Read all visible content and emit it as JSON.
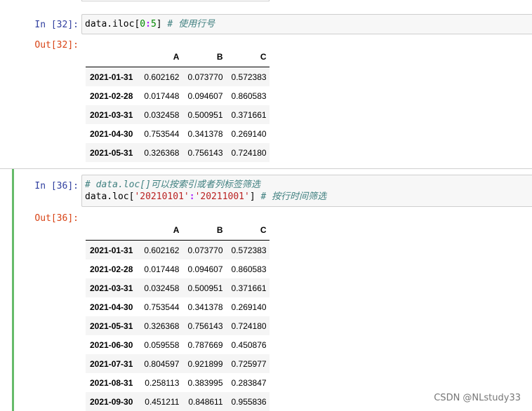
{
  "cells": [
    {
      "in_prompt": "In [32]:",
      "out_prompt": "Out[32]:",
      "code": {
        "line1": {
          "pre": "data.iloc[",
          "n1": "0",
          "colon": ":",
          "n2": "5",
          "post": "] ",
          "comment": "# 使用行号"
        }
      },
      "table": {
        "columns": [
          "A",
          "B",
          "C"
        ],
        "rows": [
          {
            "index": "2021-01-31",
            "values": [
              "0.602162",
              "0.073770",
              "0.572383"
            ]
          },
          {
            "index": "2021-02-28",
            "values": [
              "0.017448",
              "0.094607",
              "0.860583"
            ]
          },
          {
            "index": "2021-03-31",
            "values": [
              "0.032458",
              "0.500951",
              "0.371661"
            ]
          },
          {
            "index": "2021-04-30",
            "values": [
              "0.753544",
              "0.341378",
              "0.269140"
            ]
          },
          {
            "index": "2021-05-31",
            "values": [
              "0.326368",
              "0.756143",
              "0.724180"
            ]
          }
        ]
      }
    },
    {
      "in_prompt": "In [36]:",
      "out_prompt": "Out[36]:",
      "code": {
        "line1": {
          "comment": "# data.loc[]可以按索引或者列标签筛选"
        },
        "line2": {
          "pre": "data.loc[",
          "s1": "'20210101'",
          "colon": ":",
          "s2": "'20211001'",
          "post": "] ",
          "comment": "# 按行时间筛选"
        }
      },
      "table": {
        "columns": [
          "A",
          "B",
          "C"
        ],
        "rows": [
          {
            "index": "2021-01-31",
            "values": [
              "0.602162",
              "0.073770",
              "0.572383"
            ]
          },
          {
            "index": "2021-02-28",
            "values": [
              "0.017448",
              "0.094607",
              "0.860583"
            ]
          },
          {
            "index": "2021-03-31",
            "values": [
              "0.032458",
              "0.500951",
              "0.371661"
            ]
          },
          {
            "index": "2021-04-30",
            "values": [
              "0.753544",
              "0.341378",
              "0.269140"
            ]
          },
          {
            "index": "2021-05-31",
            "values": [
              "0.326368",
              "0.756143",
              "0.724180"
            ]
          },
          {
            "index": "2021-06-30",
            "values": [
              "0.059558",
              "0.787669",
              "0.450876"
            ]
          },
          {
            "index": "2021-07-31",
            "values": [
              "0.804597",
              "0.921899",
              "0.725977"
            ]
          },
          {
            "index": "2021-08-31",
            "values": [
              "0.258113",
              "0.383995",
              "0.283847"
            ]
          },
          {
            "index": "2021-09-30",
            "values": [
              "0.451211",
              "0.848611",
              "0.955836"
            ]
          }
        ]
      }
    }
  ],
  "watermark": "CSDN @NLstudy33",
  "colors": {
    "in_prompt": "#303f9f",
    "out_prompt": "#d84315",
    "selected_edit_bar": "#66bb6a",
    "input_bg": "#f7f7f7"
  }
}
